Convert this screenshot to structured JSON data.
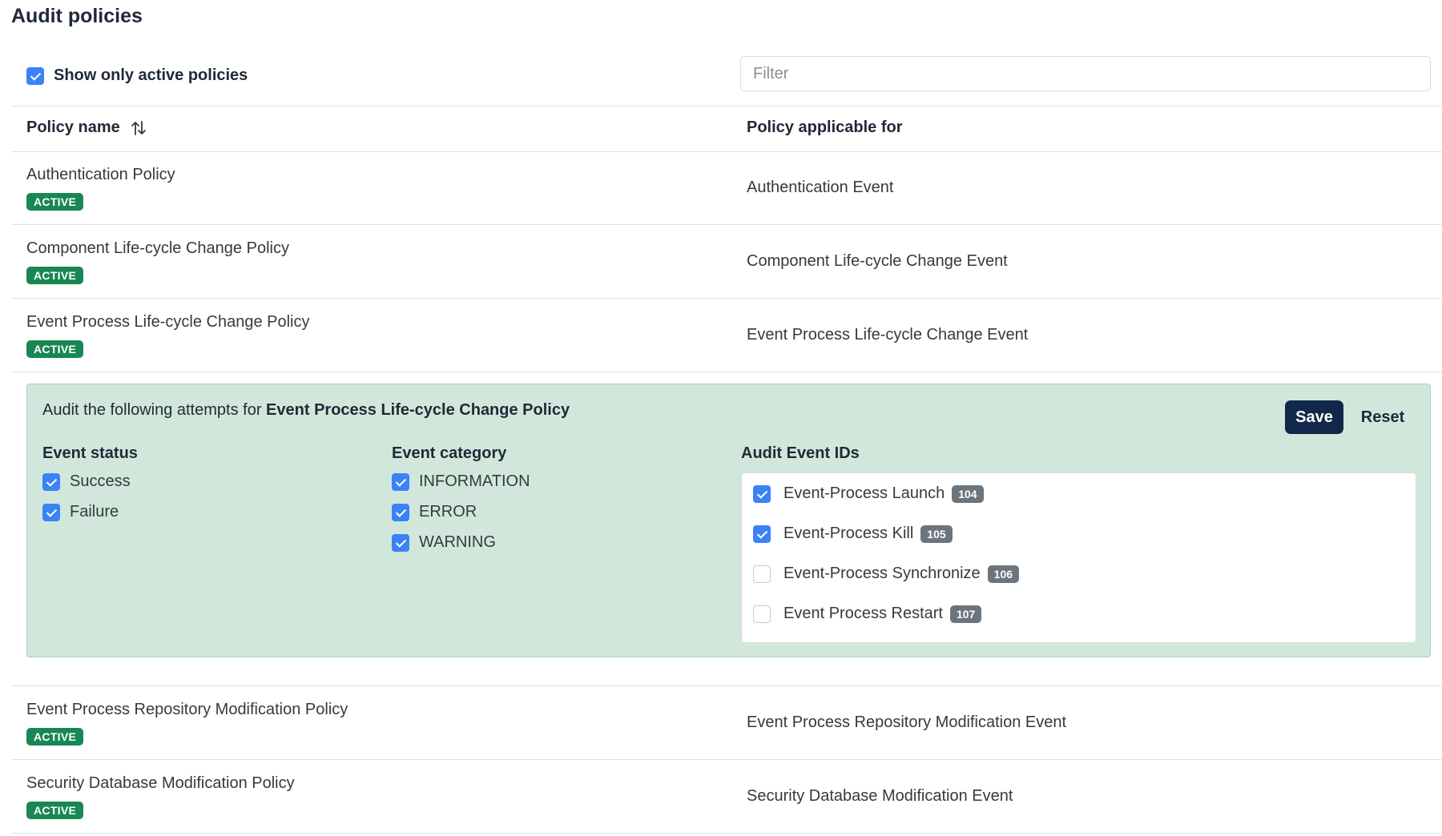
{
  "page": {
    "title": "Audit policies"
  },
  "toolbar": {
    "show_active_label": "Show only active policies",
    "show_active_checked": true,
    "filter_placeholder": "Filter",
    "filter_value": ""
  },
  "table": {
    "headers": {
      "policy_name": "Policy name",
      "applicable_for": "Policy applicable for"
    },
    "rows_before_panel": [
      {
        "name": "Authentication Policy",
        "status": "ACTIVE",
        "applicable": "Authentication Event"
      },
      {
        "name": "Component Life-cycle Change Policy",
        "status": "ACTIVE",
        "applicable": "Component Life-cycle Change Event"
      },
      {
        "name": "Event Process Life-cycle Change Policy",
        "status": "ACTIVE",
        "applicable": "Event Process Life-cycle Change Event"
      }
    ],
    "rows_after_panel": [
      {
        "name": "Event Process Repository Modification Policy",
        "status": "ACTIVE",
        "applicable": "Event Process Repository Modification Event"
      },
      {
        "name": "Security Database Modification Policy",
        "status": "ACTIVE",
        "applicable": "Security Database Modification Event"
      }
    ]
  },
  "panel": {
    "title_prefix": "Audit the following attempts for ",
    "title_policy": "Event Process Life-cycle Change Policy",
    "save_label": "Save",
    "reset_label": "Reset",
    "event_status": {
      "heading": "Event status",
      "options": [
        {
          "label": "Success",
          "checked": true
        },
        {
          "label": "Failure",
          "checked": true
        }
      ]
    },
    "event_category": {
      "heading": "Event category",
      "options": [
        {
          "label": "INFORMATION",
          "checked": true
        },
        {
          "label": "ERROR",
          "checked": true
        },
        {
          "label": "WARNING",
          "checked": true
        }
      ]
    },
    "audit_event_ids": {
      "heading": "Audit Event IDs",
      "items": [
        {
          "label": "Event-Process Launch",
          "id": "104",
          "checked": true
        },
        {
          "label": "Event-Process Kill",
          "id": "105",
          "checked": true
        },
        {
          "label": "Event-Process Synchronize",
          "id": "106",
          "checked": false
        },
        {
          "label": "Event Process Restart",
          "id": "107",
          "checked": false
        }
      ]
    }
  },
  "colors": {
    "active_badge": "#198754",
    "id_badge": "#6c757d",
    "checkbox_checked": "#3b82f6",
    "panel_background": "#d2e7dc",
    "save_button": "#12284b"
  },
  "icons": {
    "sort": "sort-arrows-icon",
    "check": "check-icon"
  }
}
